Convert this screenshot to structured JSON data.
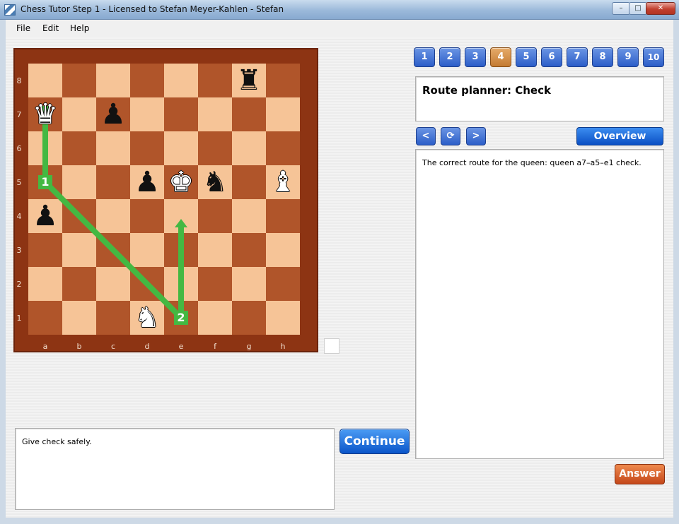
{
  "window": {
    "title": "Chess Tutor Step 1 - Licensed to Stefan Meyer-Kahlen - Stefan",
    "minimize": "–",
    "maximize": "□",
    "close": "✕"
  },
  "menu": {
    "file": "File",
    "edit": "Edit",
    "help": "Help"
  },
  "board": {
    "ranks": [
      "8",
      "7",
      "6",
      "5",
      "4",
      "3",
      "2",
      "1"
    ],
    "files": [
      "a",
      "b",
      "c",
      "d",
      "e",
      "f",
      "g",
      "h"
    ],
    "pieces": [
      {
        "name": "white-queen",
        "square": "a7",
        "glyph": "♛",
        "color": "white"
      },
      {
        "name": "black-rook",
        "square": "g8",
        "glyph": "♜",
        "color": "black"
      },
      {
        "name": "black-pawn",
        "square": "c7",
        "glyph": "♟",
        "color": "black"
      },
      {
        "name": "black-pawn",
        "square": "d5",
        "glyph": "♟",
        "color": "black"
      },
      {
        "name": "white-king",
        "square": "e5",
        "glyph": "♚",
        "color": "white"
      },
      {
        "name": "black-knight",
        "square": "f5",
        "glyph": "♞",
        "color": "black"
      },
      {
        "name": "white-bishop",
        "square": "h5",
        "glyph": "♝",
        "color": "white"
      },
      {
        "name": "black-pawn",
        "square": "a4",
        "glyph": "♟",
        "color": "black"
      },
      {
        "name": "white-knight",
        "square": "d1",
        "glyph": "♞",
        "color": "white"
      }
    ],
    "route": [
      "a7",
      "a5",
      "e1",
      "e4"
    ],
    "markers": [
      {
        "label": "1",
        "square": "a5"
      },
      {
        "label": "2",
        "square": "e1"
      }
    ]
  },
  "steps": [
    "1",
    "2",
    "3",
    "4",
    "5",
    "6",
    "7",
    "8",
    "9",
    "10"
  ],
  "active_step": 3,
  "route_title": "Route planner: Check",
  "nav": {
    "back": "<",
    "refresh": "⟳",
    "forward": ">",
    "overview": "Overview"
  },
  "route_text": "The correct route for the queen: queen a7–a5–e1 check.",
  "hint": "Give check safely.",
  "buttons": {
    "continue": "Continue",
    "answer": "Answer"
  },
  "colors": {
    "accent": "#2c5ec8",
    "active_step": "#c47b32",
    "answer": "#c4471a",
    "route": "#44b842"
  }
}
